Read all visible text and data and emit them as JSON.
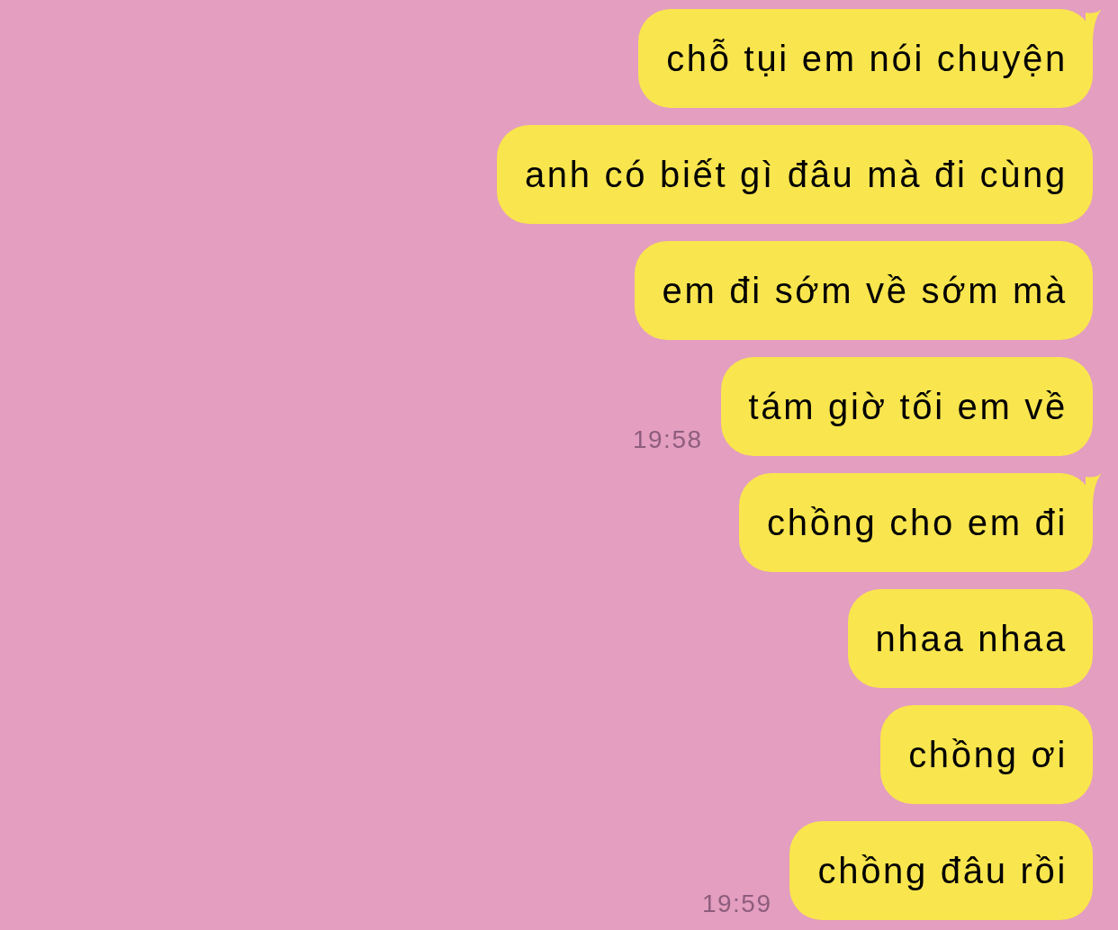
{
  "messages": [
    {
      "text": "chỗ tụi em nói chuyện",
      "tail": true
    },
    {
      "text": "anh có biết gì đâu mà đi cùng",
      "tail": false
    },
    {
      "text": "em đi sớm về sớm mà",
      "tail": false
    },
    {
      "text": "tám giờ tối em về",
      "tail": false,
      "time": "19:58"
    },
    {
      "text": "chồng cho em đi",
      "tail": true
    },
    {
      "text": "nhaa nhaa",
      "tail": false
    },
    {
      "text": "chồng ơi",
      "tail": false
    },
    {
      "text": "chồng đâu rồi",
      "tail": false,
      "time": "19:59"
    }
  ]
}
